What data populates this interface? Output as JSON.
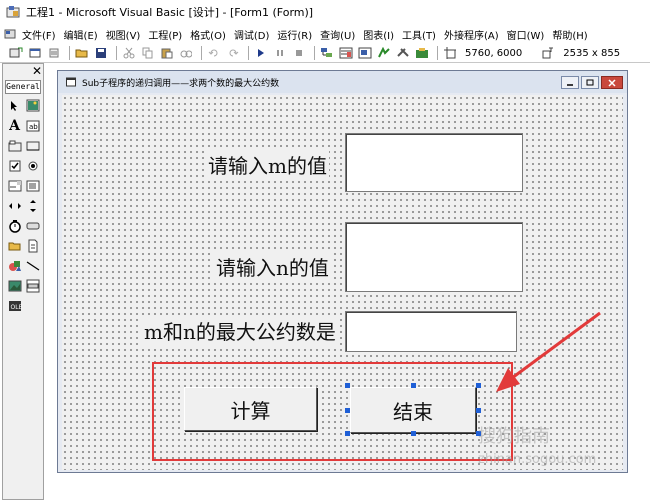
{
  "window": {
    "title": "工程1 - Microsoft Visual Basic [设计] - [Form1 (Form)]"
  },
  "menu": {
    "items": [
      "文件(F)",
      "编辑(E)",
      "视图(V)",
      "工程(P)",
      "格式(O)",
      "调试(D)",
      "运行(R)",
      "查询(U)",
      "图表(I)",
      "工具(T)",
      "外接程序(A)",
      "窗口(W)",
      "帮助(H)"
    ]
  },
  "toolbar": {
    "position_readout": "5760, 6000",
    "size_readout": "2535 x 855"
  },
  "toolbox": {
    "tab_label": "General"
  },
  "form": {
    "caption": "Sub子程序的递归调用——求两个数的最大公约数",
    "label_m": "请输入m的值",
    "label_n": "请输入n的值",
    "label_gcd": "m和n的最大公约数是",
    "btn_calc": "计算",
    "btn_end": "结束"
  },
  "watermark": {
    "line1": "搜狗指南",
    "line2": "zhinan.sogou.com"
  },
  "colors": {
    "annotation": "#e23a3a",
    "selection_handle": "#1f5fd6"
  }
}
